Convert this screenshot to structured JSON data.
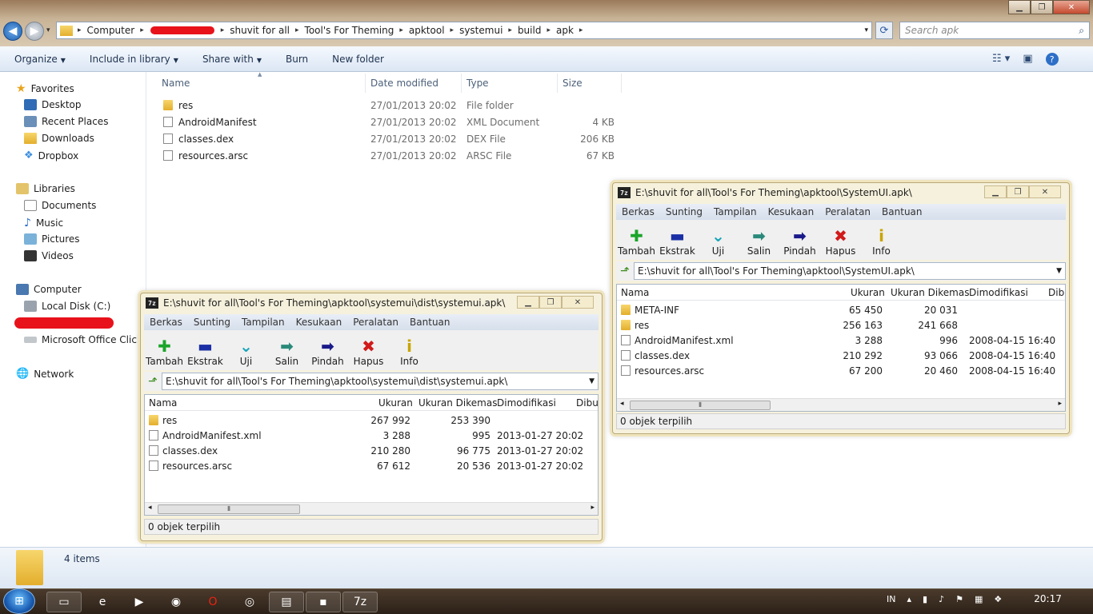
{
  "explorer": {
    "address": [
      "Computer",
      "shuvit for all",
      "Tool's For Theming",
      "apktool",
      "systemui",
      "build",
      "apk"
    ],
    "search_placeholder": "Search apk",
    "commands": [
      {
        "label": "Organize",
        "dropdown": true
      },
      {
        "label": "Include in library",
        "dropdown": true
      },
      {
        "label": "Share with",
        "dropdown": true
      },
      {
        "label": "Burn",
        "dropdown": false
      },
      {
        "label": "New folder",
        "dropdown": false
      }
    ],
    "nav": {
      "favorites": "Favorites",
      "fav_items": [
        "Desktop",
        "Recent Places",
        "Downloads",
        "Dropbox"
      ],
      "libraries": "Libraries",
      "lib_items": [
        "Documents",
        "Music",
        "Pictures",
        "Videos"
      ],
      "computer": "Computer",
      "comp_items": [
        "Local Disk (C:)",
        "Microsoft Office Click-t"
      ],
      "network": "Network"
    },
    "columns": {
      "name": "Name",
      "date": "Date modified",
      "type": "Type",
      "size": "Size"
    },
    "files": [
      {
        "name": "res",
        "date": "27/01/2013 20:02",
        "type": "File folder",
        "size": ""
      },
      {
        "name": "AndroidManifest",
        "date": "27/01/2013 20:02",
        "type": "XML Document",
        "size": "4 KB"
      },
      {
        "name": "classes.dex",
        "date": "27/01/2013 20:02",
        "type": "DEX File",
        "size": "206 KB"
      },
      {
        "name": "resources.arsc",
        "date": "27/01/2013 20:02",
        "type": "ARSC File",
        "size": "67 KB"
      }
    ],
    "item_count": "4 items"
  },
  "zip_left": {
    "title": "E:\\shuvit for all\\Tool's For Theming\\apktool\\systemui\\dist\\systemui.apk\\",
    "path": "E:\\shuvit for all\\Tool's For Theming\\apktool\\systemui\\dist\\systemui.apk\\",
    "cols": {
      "name": "Nama",
      "size": "Ukuran",
      "packed": "Ukuran Dikemas",
      "modified": "Dimodifikasi",
      "extra": "Dibu"
    },
    "rows": [
      {
        "name": "res",
        "size": "267 992",
        "packed": "253 390",
        "modified": ""
      },
      {
        "name": "AndroidManifest.xml",
        "size": "3 288",
        "packed": "995",
        "modified": "2013-01-27 20:02"
      },
      {
        "name": "classes.dex",
        "size": "210 280",
        "packed": "96 775",
        "modified": "2013-01-27 20:02"
      },
      {
        "name": "resources.arsc",
        "size": "67 612",
        "packed": "20 536",
        "modified": "2013-01-27 20:02"
      }
    ],
    "status": "0 objek terpilih"
  },
  "zip_right": {
    "title": "E:\\shuvit for all\\Tool's For Theming\\apktool\\SystemUI.apk\\",
    "path": "E:\\shuvit for all\\Tool's For Theming\\apktool\\SystemUI.apk\\",
    "cols": {
      "name": "Nama",
      "size": "Ukuran",
      "packed": "Ukuran Dikemas",
      "modified": "Dimodifikasi",
      "extra": "Dib"
    },
    "rows": [
      {
        "name": "META-INF",
        "size": "65 450",
        "packed": "20 031",
        "modified": ""
      },
      {
        "name": "res",
        "size": "256 163",
        "packed": "241 668",
        "modified": ""
      },
      {
        "name": "AndroidManifest.xml",
        "size": "3 288",
        "packed": "996",
        "modified": "2008-04-15 16:40"
      },
      {
        "name": "classes.dex",
        "size": "210 292",
        "packed": "93 066",
        "modified": "2008-04-15 16:40"
      },
      {
        "name": "resources.arsc",
        "size": "67 200",
        "packed": "20 460",
        "modified": "2008-04-15 16:40"
      }
    ],
    "status": "0 objek terpilih"
  },
  "zip_menu": [
    "Berkas",
    "Sunting",
    "Tampilan",
    "Kesukaan",
    "Peralatan",
    "Bantuan"
  ],
  "zip_tools": [
    {
      "label": "Tambah",
      "icon": "plus-icon",
      "glyph": "✚",
      "color": "#1aa52a"
    },
    {
      "label": "Ekstrak",
      "icon": "minus-icon",
      "glyph": "▬",
      "color": "#1a2fa5"
    },
    {
      "label": "Uji",
      "icon": "check-icon",
      "glyph": "⌄",
      "color": "#1aa5b8"
    },
    {
      "label": "Salin",
      "icon": "copy-arrow-icon",
      "glyph": "➡",
      "color": "#2a8a7a"
    },
    {
      "label": "Pindah",
      "icon": "move-arrow-icon",
      "glyph": "➡",
      "color": "#1a1a8a"
    },
    {
      "label": "Hapus",
      "icon": "delete-icon",
      "glyph": "✖",
      "color": "#d11a1a"
    },
    {
      "label": "Info",
      "icon": "info-icon",
      "glyph": "i",
      "color": "#c9a400"
    }
  ],
  "taskbar": {
    "lang": "IN",
    "time": "20:17"
  }
}
